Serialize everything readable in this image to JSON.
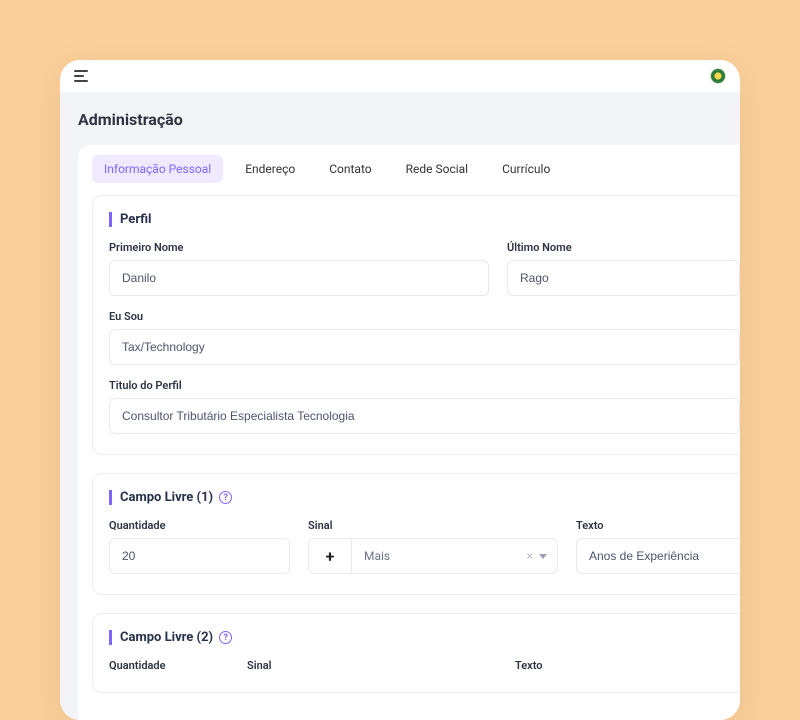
{
  "header": {
    "title": "Administração"
  },
  "tabs": [
    {
      "label": "Informação Pessoal",
      "active": true
    },
    {
      "label": "Endereço",
      "active": false
    },
    {
      "label": "Contato",
      "active": false
    },
    {
      "label": "Rede Social",
      "active": false
    },
    {
      "label": "Currículo",
      "active": false
    }
  ],
  "perfil": {
    "section_title": "Perfil",
    "first_name_label": "Primeiro Nome",
    "first_name_value": "Danilo",
    "last_name_label": "Último Nome",
    "last_name_value": "Rago",
    "eu_sou_label": "Eu Sou",
    "eu_sou_value": "Tax/Technology",
    "titulo_label": "Titulo do Perfil",
    "titulo_value": "Consultor Tributário Especialista Tecnologia"
  },
  "campo_livre_1": {
    "section_title": "Campo Livre (1)",
    "quantidade_label": "Quantidade",
    "quantidade_value": "20",
    "sinal_label": "Sinal",
    "sinal_button": "+",
    "sinal_selected": "Mais",
    "texto_label": "Texto",
    "texto_value": "Anos de Experiência"
  },
  "campo_livre_2": {
    "section_title": "Campo Livre (2)",
    "quantidade_label": "Quantidade",
    "sinal_label": "Sinal",
    "texto_label": "Texto"
  },
  "icons": {
    "help": "?"
  }
}
